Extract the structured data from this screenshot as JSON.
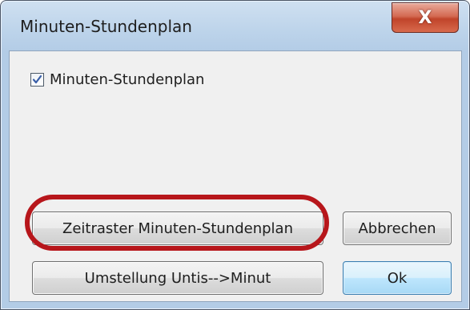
{
  "window": {
    "title": "Minuten-Stundenplan",
    "close_glyph": "X",
    "close_icon": "close-icon"
  },
  "options": {
    "checkbox_label": "Minuten-Stundenplan",
    "checkbox_checked": true
  },
  "buttons": {
    "zeitraster_label": "Zeitraster Minuten-Stundenplan",
    "abbrechen_label": "Abbrechen",
    "umstellung_label": "Umstellung Untis-->Minut",
    "ok_label": "Ok"
  },
  "annotation": {
    "highlight_color": "#b7161b"
  },
  "colors": {
    "title_bar": "#bcd3ea",
    "client_bg": "#f0f0f0",
    "close_button": "#c0442a",
    "checkmark": "#3a5fa8"
  }
}
